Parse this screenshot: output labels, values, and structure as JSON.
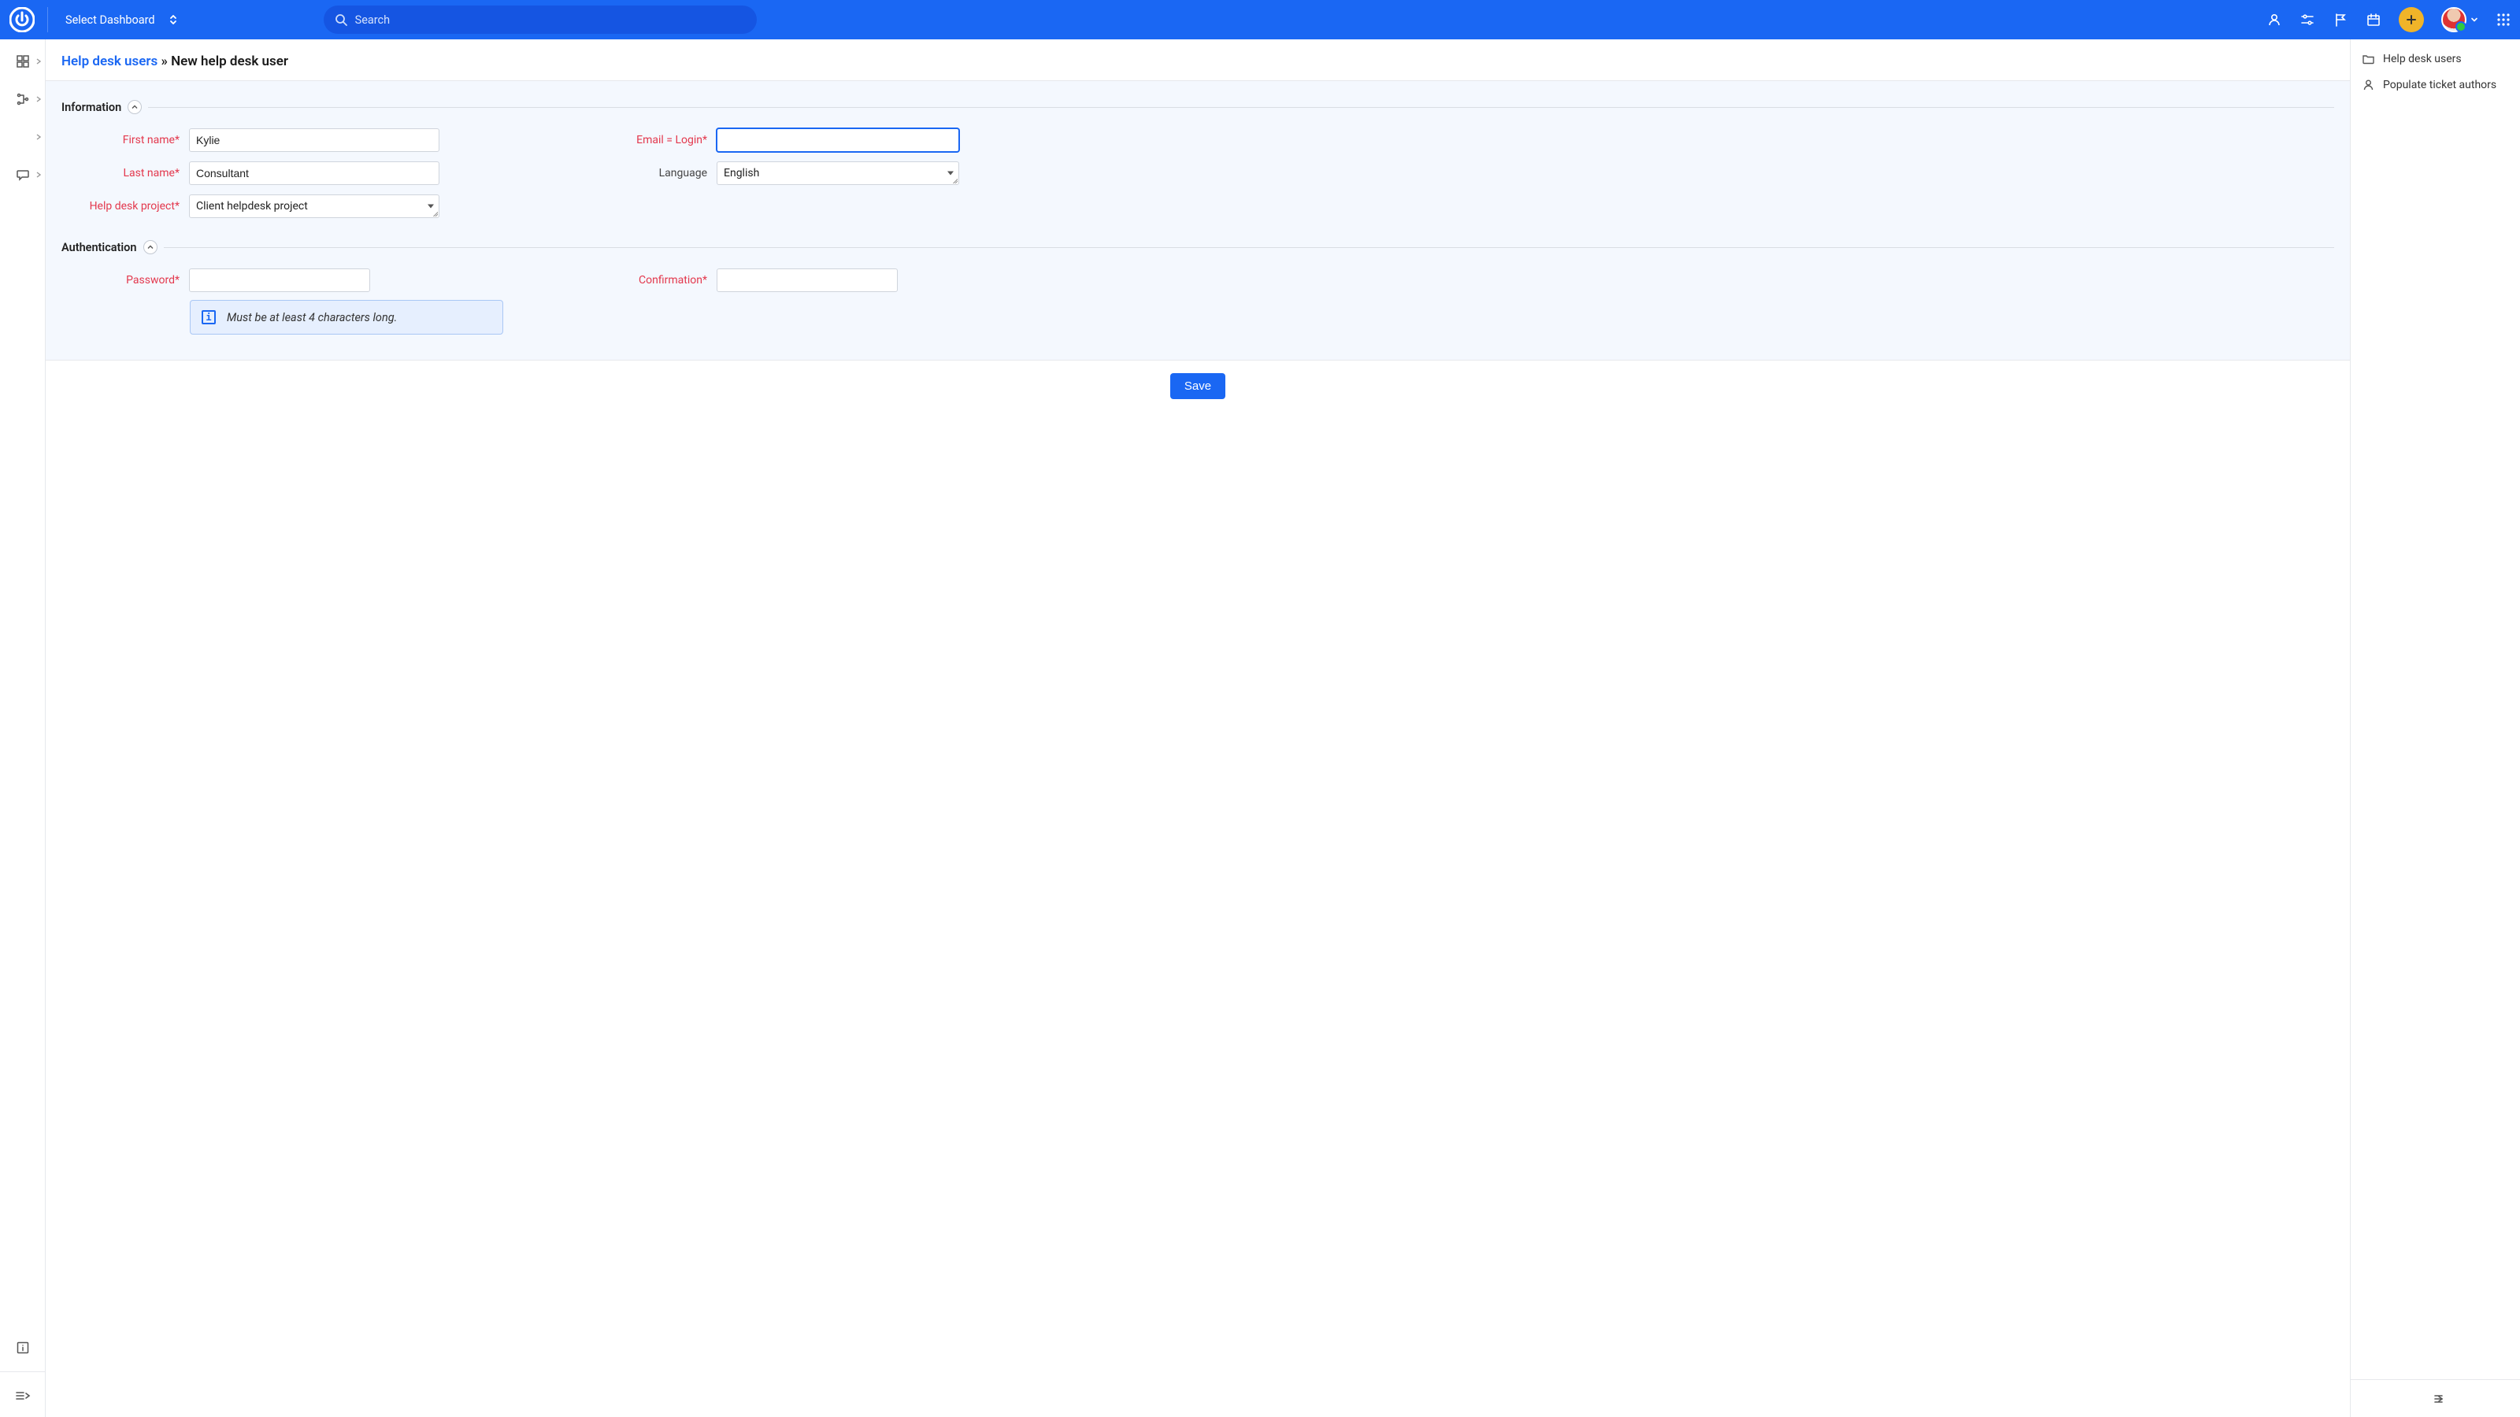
{
  "topbar": {
    "dashboard_label": "Select Dashboard",
    "search_placeholder": "Search"
  },
  "breadcrumb": {
    "link": "Help desk users",
    "sep": " » ",
    "current": "New help desk user"
  },
  "sections": {
    "information": "Information",
    "authentication": "Authentication"
  },
  "labels": {
    "first_name": "First name*",
    "last_name": "Last name*",
    "help_desk_project": "Help desk project*",
    "email_login": "Email = Login*",
    "language": "Language",
    "password": "Password*",
    "confirmation": "Confirmation*"
  },
  "values": {
    "first_name": "Kylie",
    "last_name": "Consultant",
    "help_desk_project": "Client helpdesk project",
    "email_login": "",
    "language": "English",
    "password": "",
    "confirmation": ""
  },
  "hint": "Must be at least 4 characters long.",
  "buttons": {
    "save": "Save"
  },
  "rightpanel": {
    "items": [
      {
        "label": "Help desk users"
      },
      {
        "label": "Populate ticket authors"
      }
    ]
  }
}
